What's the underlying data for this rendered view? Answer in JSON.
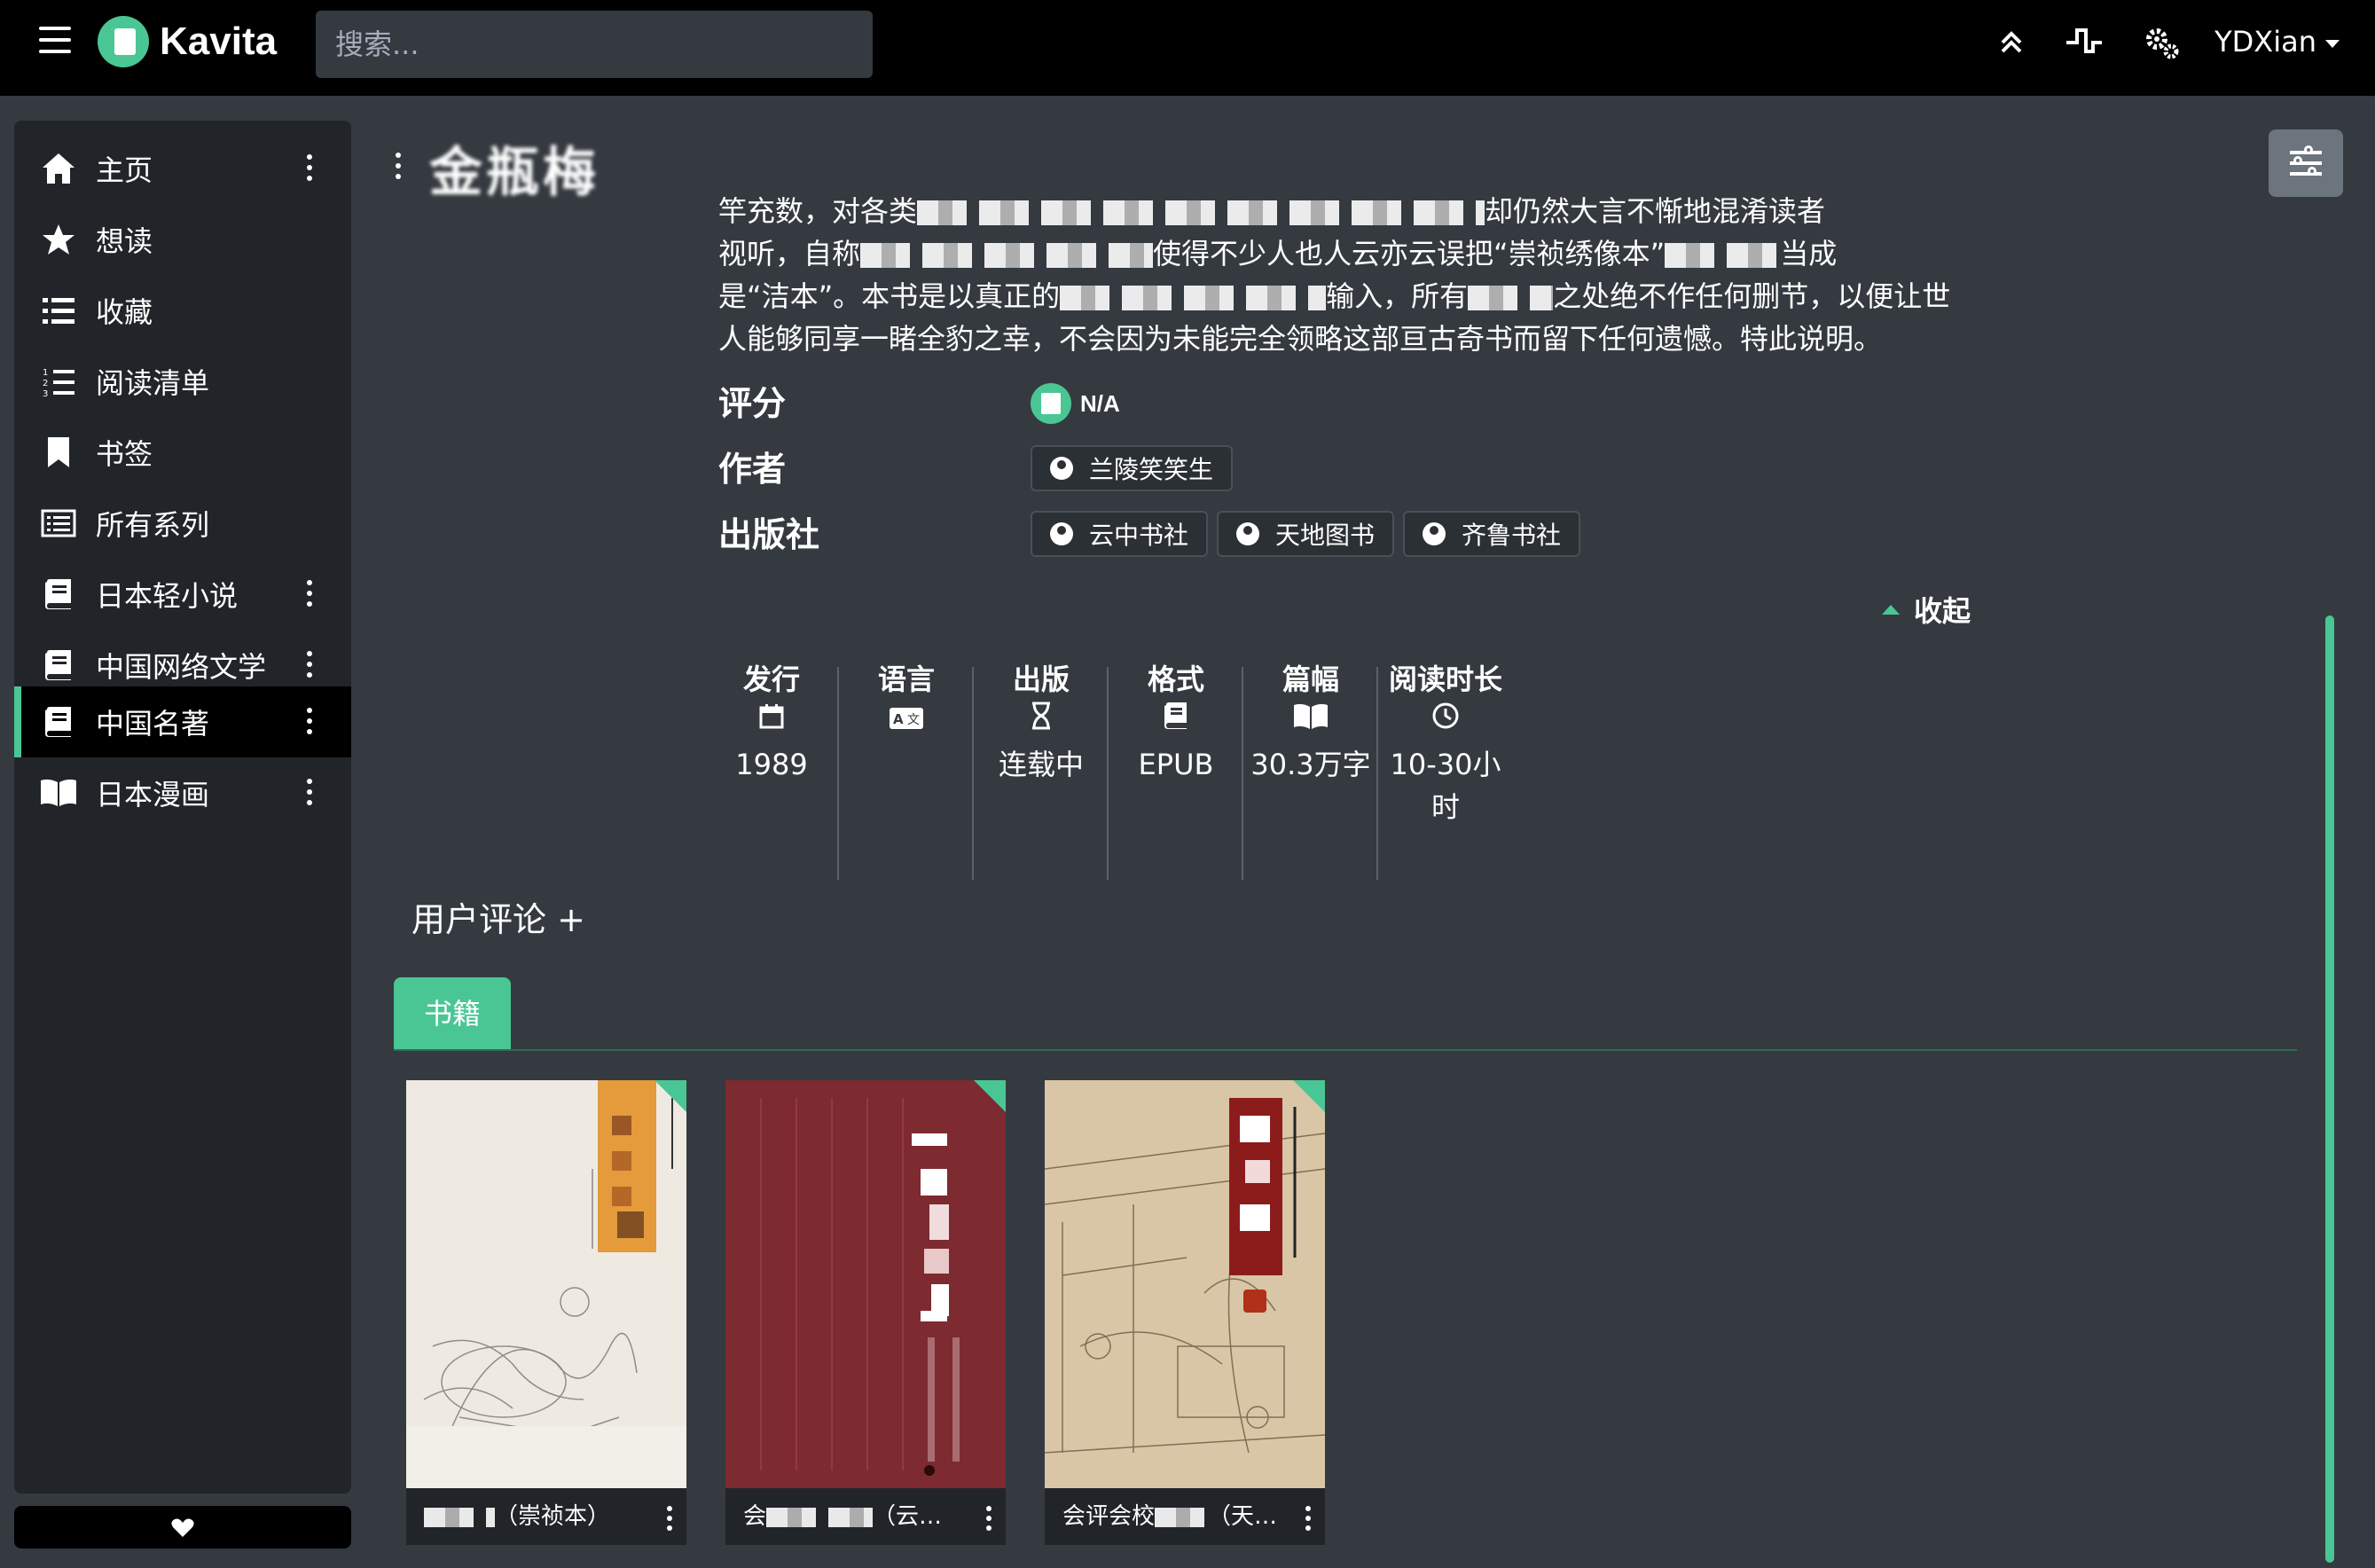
{
  "nav": {
    "brand": "Kavita",
    "search_placeholder": "搜索...",
    "user": "YDXian"
  },
  "sidebar": {
    "items": [
      {
        "label": "主页",
        "icon": "home-icon"
      },
      {
        "label": "想读",
        "icon": "star-icon"
      },
      {
        "label": "收藏",
        "icon": "list-icon"
      },
      {
        "label": "阅读清单",
        "icon": "ordered-list-icon"
      },
      {
        "label": "书签",
        "icon": "bookmark-icon"
      },
      {
        "label": "所有系列",
        "icon": "all-series-icon"
      },
      {
        "label": "日本轻小说",
        "icon": "book-icon"
      },
      {
        "label": "中国网络文学",
        "icon": "book-icon"
      },
      {
        "label": "中国名著",
        "icon": "book-icon",
        "active": true
      },
      {
        "label": "日本漫画",
        "icon": "open-book-icon"
      }
    ]
  },
  "series": {
    "title": "金瓶梅",
    "desc_lines": [
      [
        "竿充数，对各类",
        "却仍然大言不惭地混淆读者"
      ],
      [
        "视听，自称",
        "使得不少人也人云亦云误把“崇祯绣像本”",
        "当成"
      ],
      [
        "是“洁本”。本书是以真正的",
        "输入，所有",
        "之处绝不作任何删节，以便让世"
      ],
      [
        "人能够同享一睹全豹之幸，不会因为未能完全领略这部亘古奇书而留下任何遗憾。特此说明。"
      ]
    ],
    "rating_label": "评分",
    "rating_value": "N/A",
    "author_label": "作者",
    "authors": [
      "兰陵笑笑生"
    ],
    "publisher_label": "出版社",
    "publishers": [
      "云中书社",
      "天地图书",
      "齐鲁书社"
    ],
    "collapse_label": "收起"
  },
  "stats": [
    {
      "label": "发行",
      "icon": "calendar-icon",
      "value": "1989"
    },
    {
      "label": "语言",
      "icon": "language-icon",
      "value": ""
    },
    {
      "label": "出版",
      "icon": "hourglass-icon",
      "value": "连载中"
    },
    {
      "label": "格式",
      "icon": "file-icon",
      "value": "EPUB"
    },
    {
      "label": "篇幅",
      "icon": "book-open-icon",
      "value": "30.3万字"
    },
    {
      "label": "阅读时长",
      "icon": "clock-icon",
      "value": "10-30小时"
    }
  ],
  "reviews_label": "用户评论 +",
  "tab_books": "书籍",
  "books": [
    {
      "title": "（崇祯本）"
    },
    {
      "title": "会",
      "suffix": "（云…"
    },
    {
      "title": "会评会校",
      "suffix": "（天…"
    }
  ]
}
